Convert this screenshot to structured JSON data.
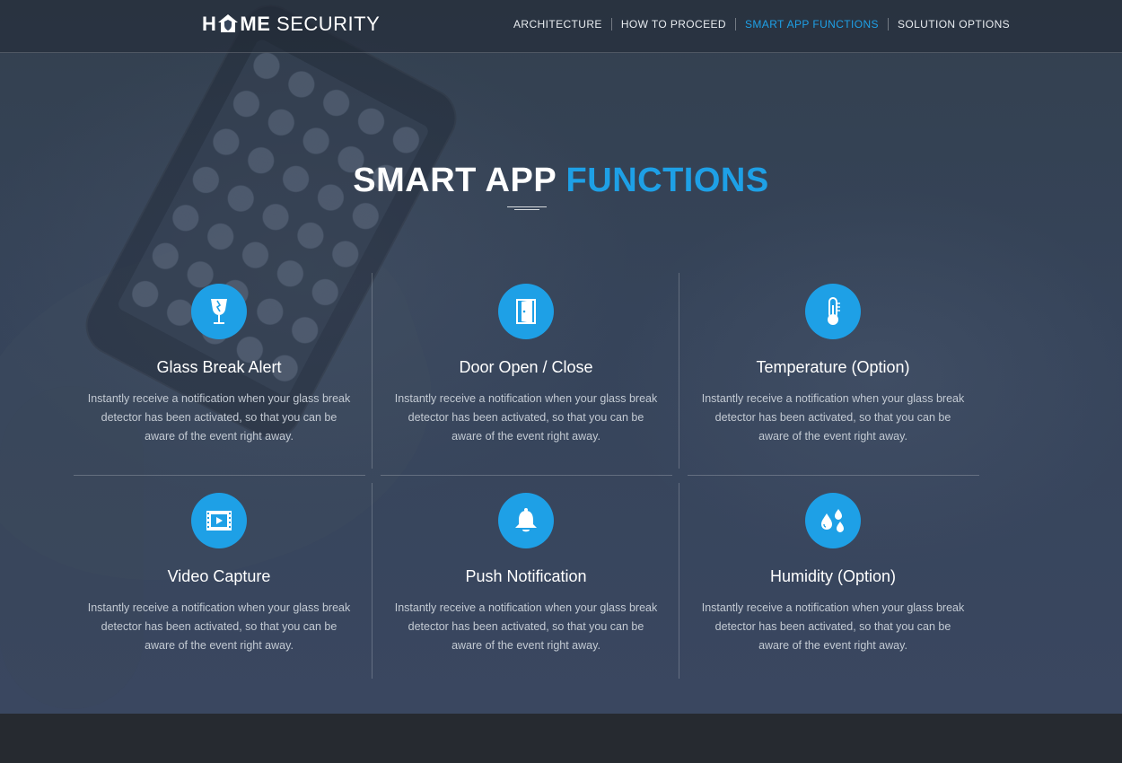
{
  "header": {
    "logo": {
      "part1": "H",
      "part2": "ME",
      "part3": "SECURITY"
    },
    "nav": [
      {
        "label": "ARCHITECTURE",
        "active": false
      },
      {
        "label": "HOW TO PROCEED",
        "active": false
      },
      {
        "label": "SMART APP FUNCTIONS",
        "active": true
      },
      {
        "label": "SOLUTION OPTIONS",
        "active": false
      }
    ]
  },
  "section": {
    "title_white": "SMART APP",
    "title_blue": "FUNCTIONS"
  },
  "features": [
    {
      "icon": "glass-break-icon",
      "title": "Glass Break Alert",
      "desc": "Instantly receive a notification when your glass break detector has been activated, so that you can be aware of the event right away."
    },
    {
      "icon": "door-icon",
      "title": "Door Open / Close",
      "desc": "Instantly receive a notification when your glass break detector has been activated, so that you can be aware of the event right away."
    },
    {
      "icon": "thermometer-icon",
      "title": "Temperature (Option)",
      "desc": "Instantly receive a notification when your glass break detector has been activated, so that you can be aware of the event right away."
    },
    {
      "icon": "video-icon",
      "title": "Video Capture",
      "desc": "Instantly receive a notification when your glass break detector has been activated, so that you can be aware of the event right away."
    },
    {
      "icon": "bell-icon",
      "title": "Push Notification",
      "desc": "Instantly receive a notification when your glass break detector has been activated, so that you can be aware of the event right away."
    },
    {
      "icon": "humidity-icon",
      "title": "Humidity (Option)",
      "desc": "Instantly receive a notification when your glass break detector has been activated, so that you can be aware of the event right away."
    }
  ],
  "colors": {
    "accent": "#1ea0e6",
    "footer": "#262a30"
  }
}
